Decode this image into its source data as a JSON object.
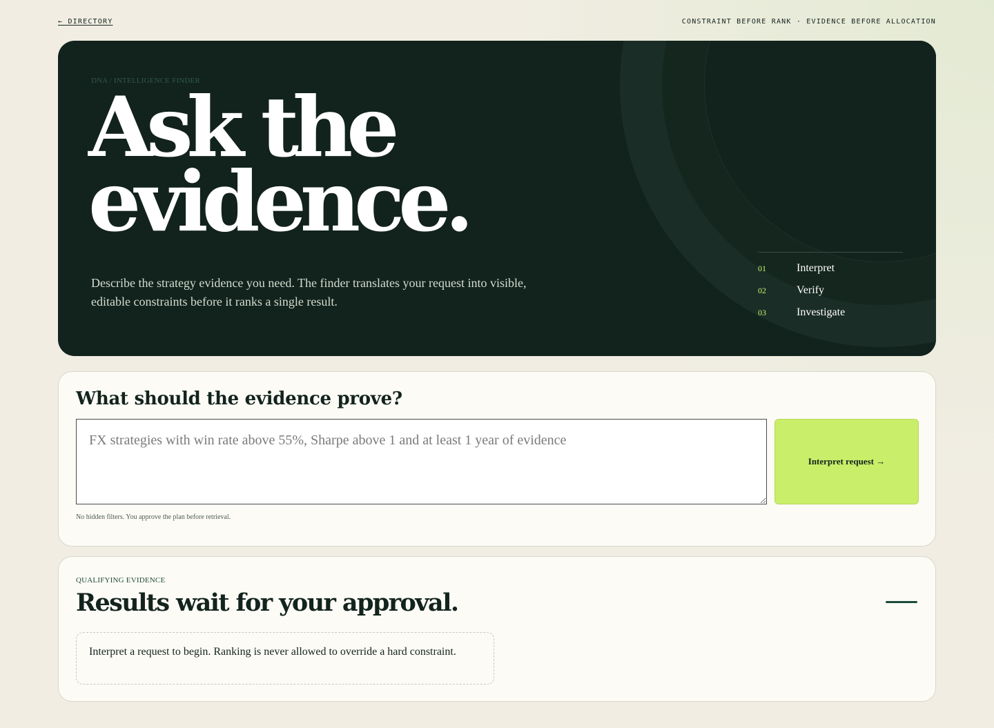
{
  "topbar": {
    "back_link": "← DIRECTORY",
    "tagline": "CONSTRAINT BEFORE RANK · EVIDENCE BEFORE ALLOCATION"
  },
  "hero": {
    "eyebrow": "DNA / INTELLIGENCE FINDER",
    "headline_line1": "Ask the",
    "headline_line2": "evidence.",
    "description": "Describe the strategy evidence you need. The finder translates your request into visible, editable constraints before it ranks a single result.",
    "steps": [
      {
        "num": "01",
        "label": "Interpret"
      },
      {
        "num": "02",
        "label": "Verify"
      },
      {
        "num": "03",
        "label": "Investigate"
      }
    ]
  },
  "query": {
    "title": "What should the evidence prove?",
    "input_value": "",
    "input_placeholder": "FX strategies with win rate above 55%, Sharpe above 1 and at least 1 year of evidence",
    "button_label": "Interpret request →",
    "note": "No hidden filters. You approve the plan before retrieval."
  },
  "results": {
    "eyebrow": "QUALIFYING EVIDENCE",
    "title": "Results wait for your approval.",
    "empty_message": "Interpret a request to begin. Ranking is never allowed to override a hard constraint."
  },
  "colors": {
    "hero_bg": "#12221d",
    "accent": "#c9ee69",
    "page_bg": "#f1ede3"
  }
}
